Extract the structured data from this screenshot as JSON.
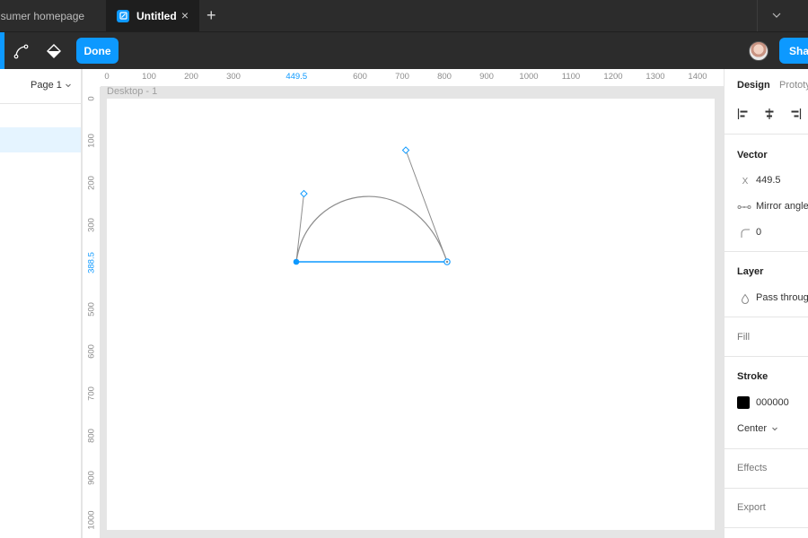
{
  "tabs": {
    "file1": "nsumer homepage",
    "file2": "Untitled",
    "close_glyph": "×",
    "add_glyph": "+"
  },
  "toolbar": {
    "done_label": "Done",
    "share_label": "Share"
  },
  "left_panel": {
    "page_label": "Page 1"
  },
  "rulers": {
    "x_ticks": [
      "0",
      "100",
      "200",
      "300",
      "449.5",
      "600",
      "700",
      "800",
      "900",
      "1000",
      "1100",
      "1200",
      "1300",
      "1400"
    ],
    "x_selected": "449.5",
    "y_ticks": [
      "0",
      "100",
      "200",
      "300",
      "388.5",
      "500",
      "600",
      "700",
      "800",
      "900",
      "1000"
    ],
    "y_selected": "388.5"
  },
  "canvas": {
    "frame_label": "Desktop - 1"
  },
  "design_panel": {
    "tab_design": "Design",
    "tab_prototype": "Prototype",
    "vector_title": "Vector",
    "x_label": "X",
    "x_value": "449.5",
    "mirror_label": "Mirror angle",
    "radius_value": "0",
    "layer_title": "Layer",
    "blend_mode": "Pass through",
    "fill_title": "Fill",
    "stroke_title": "Stroke",
    "stroke_color": "000000",
    "stroke_align": "Center",
    "effects_title": "Effects",
    "export_title": "Export"
  },
  "colors": {
    "accent": "#0d99ff",
    "chrome": "#2c2c2c",
    "stroke_swatch": "#000000"
  }
}
